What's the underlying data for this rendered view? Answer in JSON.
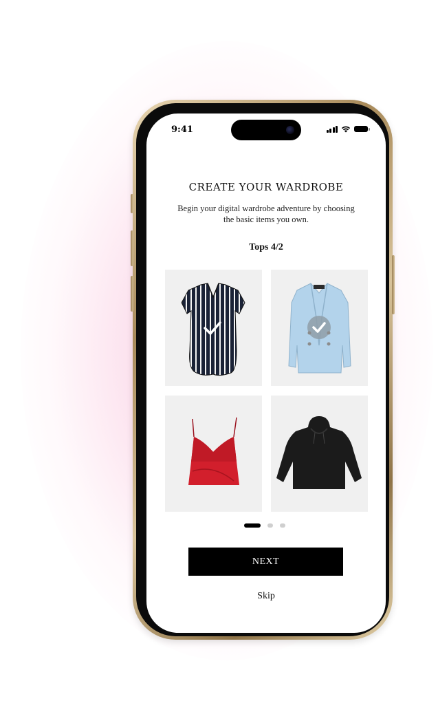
{
  "status_bar": {
    "time": "9:41",
    "icons": [
      "signal-icon",
      "wifi-icon",
      "battery-icon"
    ]
  },
  "onboarding": {
    "title": "CREATE YOUR WARDROBE",
    "subtitle": "Begin your digital wardrobe adventure by choosing the basic items you own.",
    "section_label": "Tops 4/2",
    "items": [
      {
        "name": "striped blouse",
        "selected": true
      },
      {
        "name": "light blue blazer",
        "selected": true
      },
      {
        "name": "red camisole",
        "selected": false
      },
      {
        "name": "black hoodie",
        "selected": false
      }
    ],
    "pagination": {
      "pages": 3,
      "current": 1
    },
    "next_label": "NEXT",
    "skip_label": "Skip"
  },
  "colors": {
    "accent": "#000000",
    "background_glow": "#f8bedb",
    "phone_frame": "#c8b083",
    "card_background": "#f0f0f0"
  }
}
